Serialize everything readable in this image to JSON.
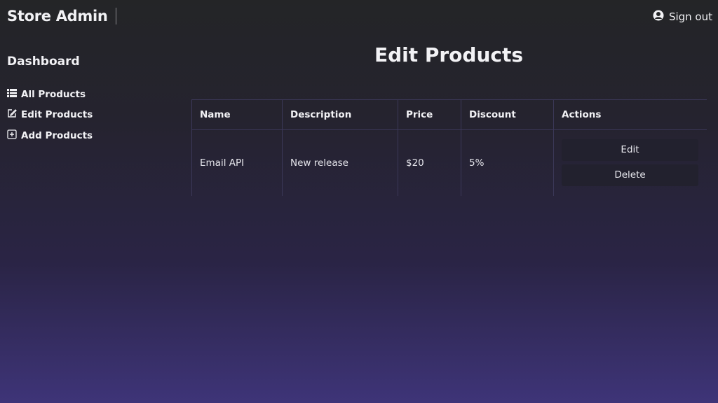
{
  "header": {
    "brand": "Store Admin",
    "signout_label": "Sign out"
  },
  "sidebar": {
    "title": "Dashboard",
    "items": [
      {
        "label": "All Products",
        "icon": "list-icon"
      },
      {
        "label": "Edit Products",
        "icon": "edit-icon"
      },
      {
        "label": "Add Products",
        "icon": "plus-square-icon"
      }
    ]
  },
  "main": {
    "title": "Edit Products",
    "table": {
      "headers": [
        "Name",
        "Description",
        "Price",
        "Discount",
        "Actions"
      ],
      "rows": [
        {
          "name": "Email API",
          "description": "New release",
          "price": "$20",
          "discount": "5%",
          "edit_label": "Edit",
          "delete_label": "Delete"
        }
      ]
    }
  }
}
